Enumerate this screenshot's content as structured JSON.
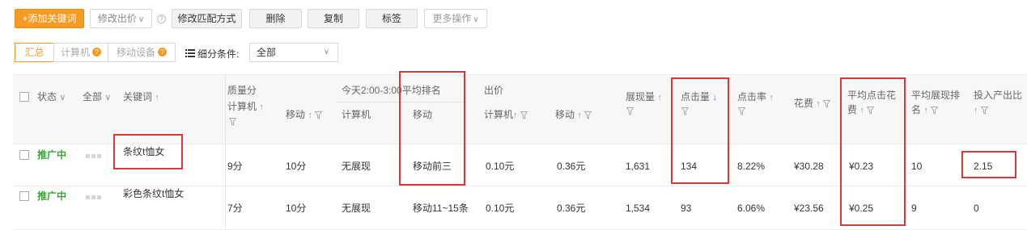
{
  "toolbar": {
    "add_keyword": "+添加关键词",
    "modify_bid": "修改出价",
    "modify_match": "修改匹配方式",
    "delete": "删除",
    "copy": "复制",
    "tag": "标签",
    "more_ops": "更多操作"
  },
  "tabs": {
    "summary": "汇总",
    "computer": "计算机",
    "mobile": "移动设备",
    "filter_label": "细分条件:",
    "filter_value": "全部"
  },
  "headers": {
    "status": "状态",
    "all": "全部",
    "keyword": "关键词",
    "quality": "质量分",
    "quality_pc": "计算机",
    "quality_mobile": "移动",
    "rank_group": "今天2:00-3:00平均排名",
    "rank_pc": "计算机",
    "rank_mobile": "移动",
    "bid": "出价",
    "bid_pc": "计算机",
    "bid_mobile": "移动",
    "impressions": "展现量",
    "clicks": "点击量",
    "ctr": "点击率",
    "cost": "花费",
    "avg_cpc_1": "平均点击花",
    "avg_cpc_2": "费",
    "avg_rank_1": "平均展现排",
    "avg_rank_2": "名",
    "roi": "投入产出比"
  },
  "rows": [
    {
      "status": "推广中",
      "keyword": "条纹t恤女",
      "quality_pc": "9分",
      "quality_mobile": "10分",
      "rank_pc": "无展现",
      "rank_mobile": "移动前三",
      "bid_pc": "0.10元",
      "bid_mobile": "0.36元",
      "impressions": "1,631",
      "clicks": "134",
      "ctr": "8.22%",
      "cost": "¥30.28",
      "avg_cpc": "¥0.23",
      "avg_rank": "10",
      "roi": "2.15"
    },
    {
      "status": "推广中",
      "keyword": "彩色条纹t恤女",
      "quality_pc": "7分",
      "quality_mobile": "10分",
      "rank_pc": "无展现",
      "rank_mobile": "移动11~15条",
      "bid_pc": "0.10元",
      "bid_mobile": "0.36元",
      "impressions": "1,534",
      "clicks": "93",
      "ctr": "6.06%",
      "cost": "¥23.56",
      "avg_cpc": "¥0.25",
      "avg_rank": "9",
      "roi": "0"
    }
  ],
  "colors": {
    "accent": "#f59a23",
    "status_green": "#3aa535",
    "highlight_red": "#d9383a",
    "sort_blue": "#2b7cd3"
  }
}
